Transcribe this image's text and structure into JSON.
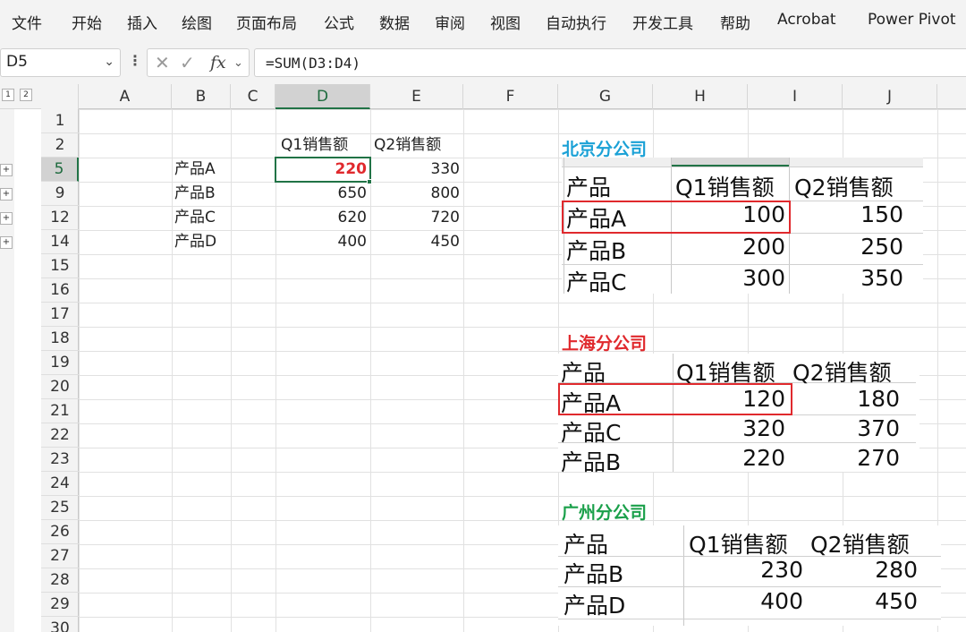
{
  "menu": [
    "文件",
    "开始",
    "插入",
    "绘图",
    "页面布局",
    "公式",
    "数据",
    "审阅",
    "视图",
    "自动执行",
    "开发工具",
    "帮助",
    "Acrobat",
    "Power Pivot"
  ],
  "formula_bar": {
    "name_box": "D5",
    "formula": "=SUM(D3:D4)",
    "fx": "fx"
  },
  "outline_levels": [
    "1",
    "2"
  ],
  "columns": [
    "A",
    "B",
    "C",
    "D",
    "E",
    "F",
    "G",
    "H",
    "I",
    "J"
  ],
  "rows": [
    "1",
    "2",
    "5",
    "9",
    "12",
    "14",
    "15",
    "16",
    "17",
    "18",
    "19",
    "20",
    "21",
    "22",
    "23",
    "24",
    "25",
    "26",
    "27",
    "28",
    "29",
    "30"
  ],
  "summary": {
    "headers": [
      "Q1销售额",
      "Q2销售额"
    ],
    "rows": [
      {
        "product": "产品A",
        "q1": "220",
        "q2": "330"
      },
      {
        "product": "产品B",
        "q1": "650",
        "q2": "800"
      },
      {
        "product": "产品C",
        "q1": "620",
        "q2": "720"
      },
      {
        "product": "产品D",
        "q1": "400",
        "q2": "450"
      }
    ]
  },
  "branches": [
    {
      "title": "北京分公司",
      "title_color": "#1ba1d6",
      "headers": [
        "产品",
        "Q1销售额",
        "Q2销售额"
      ],
      "rows": [
        [
          "产品A",
          "100",
          "150"
        ],
        [
          "产品B",
          "200",
          "250"
        ],
        [
          "产品C",
          "300",
          "350"
        ]
      ]
    },
    {
      "title": "上海分公司",
      "title_color": "#e0292d",
      "headers": [
        "产品",
        "Q1销售额",
        "Q2销售额"
      ],
      "rows": [
        [
          "产品A",
          "120",
          "180"
        ],
        [
          "产品C",
          "320",
          "370"
        ],
        [
          "产品B",
          "220",
          "270"
        ]
      ]
    },
    {
      "title": "广州分公司",
      "title_color": "#1aa04a",
      "headers": [
        "产品",
        "Q1销售额",
        "Q2销售额"
      ],
      "rows": [
        [
          "产品B",
          "230",
          "280"
        ],
        [
          "产品D",
          "400",
          "450"
        ]
      ]
    }
  ],
  "colors": {
    "accent_green": "#217346",
    "highlight_red": "#e0292d"
  }
}
